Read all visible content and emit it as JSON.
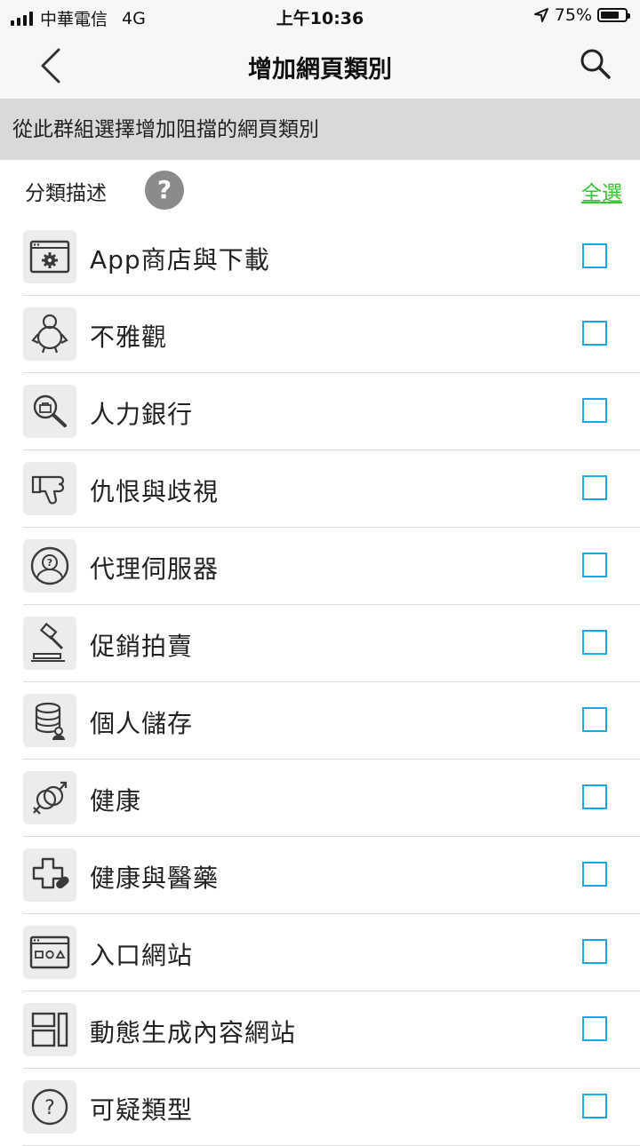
{
  "status_bar": {
    "carrier": "中華電信",
    "network": "4G",
    "time": "上午10:36",
    "battery_text": "75%",
    "battery_level": 0.75
  },
  "nav": {
    "title": "增加網頁類別",
    "back_icon": "chevron-left-icon",
    "search_icon": "search-icon"
  },
  "subheader": {
    "text": "從此群組選擇增加阻擋的網頁類別"
  },
  "list_header": {
    "label": "分類描述",
    "help_symbol": "?",
    "select_all": "全選",
    "select_all_color": "#35c635"
  },
  "checkbox_color": "#1aa8e8",
  "categories": [
    {
      "label": "App商店與下載",
      "icon": "app-store-gear-icon",
      "checked": false
    },
    {
      "label": "不雅觀",
      "icon": "person-icon",
      "checked": false
    },
    {
      "label": "人力銀行",
      "icon": "job-search-icon",
      "checked": false
    },
    {
      "label": "仇恨與歧視",
      "icon": "thumbs-down-icon",
      "checked": false
    },
    {
      "label": "代理伺服器",
      "icon": "proxy-question-icon",
      "checked": false
    },
    {
      "label": "促銷拍賣",
      "icon": "auction-gavel-icon",
      "checked": false
    },
    {
      "label": "個人儲存",
      "icon": "database-storage-icon",
      "checked": false
    },
    {
      "label": "健康",
      "icon": "gender-symbols-icon",
      "checked": false
    },
    {
      "label": "健康與醫藥",
      "icon": "medical-cross-pill-icon",
      "checked": false
    },
    {
      "label": "入口網站",
      "icon": "portal-window-icon",
      "checked": false
    },
    {
      "label": "動態生成內容網站",
      "icon": "dynamic-layout-icon",
      "checked": false
    },
    {
      "label": "可疑類型",
      "icon": "question-circle-icon",
      "checked": false
    }
  ]
}
